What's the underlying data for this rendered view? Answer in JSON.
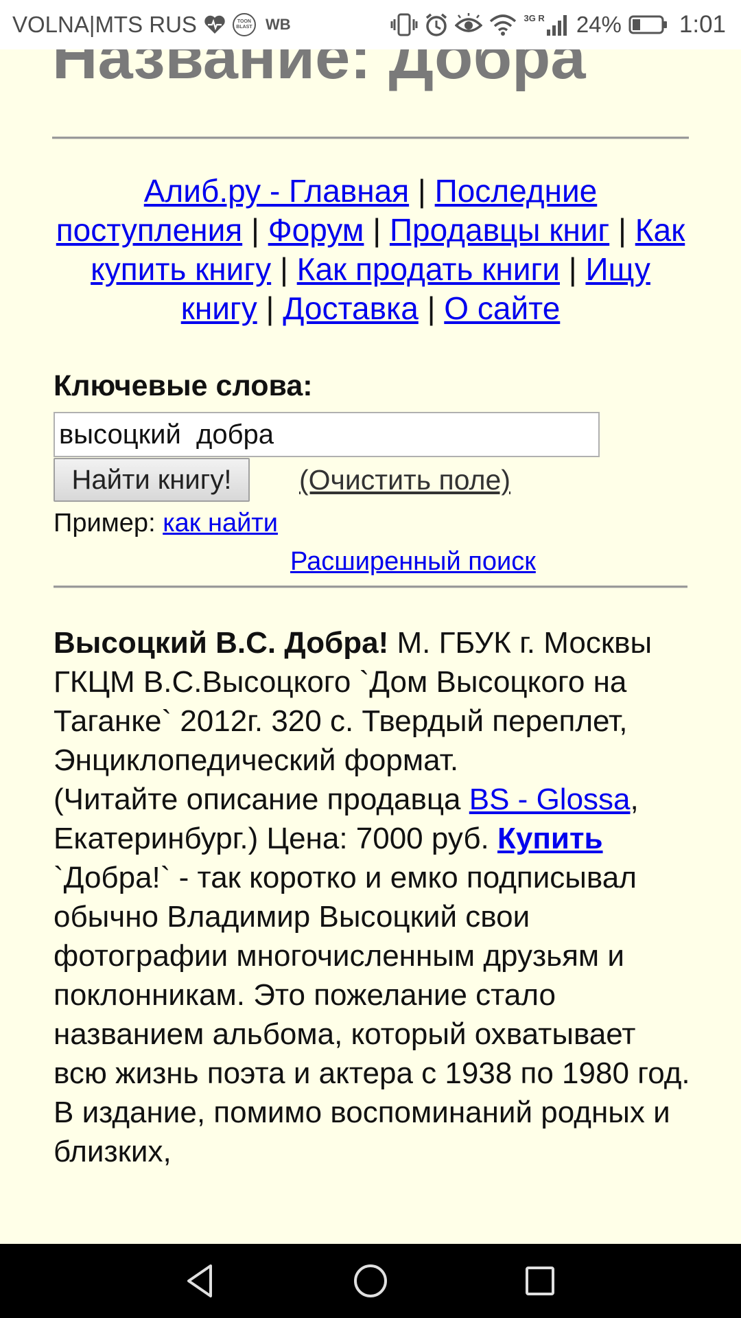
{
  "status_bar": {
    "carrier": "VOLNA|MTS RUS",
    "toon_badge": "TOON BLAST",
    "wb_label": "WB",
    "network_label": "3G R",
    "battery_percent": "24%",
    "time": "1:01"
  },
  "page": {
    "title": "Название: Добра",
    "nav_links": {
      "home": "Алиб.ру - Главная",
      "latest": "Последние поступления",
      "forum": "Форум",
      "sellers": "Продавцы книг",
      "how_to_buy": "Как купить книгу",
      "how_to_sell": "Как продать книги",
      "wanted": "Ищу книгу",
      "delivery": "Доставка",
      "about": "О сайте"
    },
    "separator": "|"
  },
  "search": {
    "label": "Ключевые слова:",
    "value": "высоцкий  добра",
    "button_label": "Найти книгу!",
    "clear_label": "(Очистить поле)",
    "example_prefix": "Пример: ",
    "example_link": "как найти",
    "advanced_link": "Расширенный поиск"
  },
  "result": {
    "title_bold": "Высоцкий В.С. Добра!",
    "details": " М. ГБУК г. Москвы ГКЦМ В.С.Высоцкого `Дом Высоцкого на Таганке` 2012г. 320 с. Твердый переплет, Энциклопедический формат.",
    "seller_prefix": "(Читайте описание продавца ",
    "seller_link": "BS - Glossa",
    "seller_suffix": ", Екатеринбург.) Цена: 7000 руб. ",
    "buy_link": "Купить",
    "description": "`Добра!` - так коротко и емко подписывал обычно Владимир Высоцкий свои фотографии многочисленным друзьям и поклонникам. Это пожелание стало названием альбома, который охватывает всю жизнь поэта и актера с 1938 по 1980 год. В издание, помимо воспоминаний родных и близких,"
  },
  "colors": {
    "page_background": "#ffffe8",
    "link": "#0000ee",
    "title": "#7a7a7a"
  }
}
